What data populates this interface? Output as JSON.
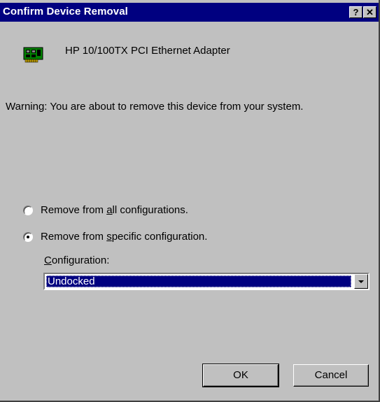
{
  "window": {
    "title": "Confirm Device Removal",
    "help_glyph": "?",
    "close_glyph": "✕"
  },
  "device": {
    "name": "HP 10/100TX PCI Ethernet Adapter",
    "icon": "network-card-icon"
  },
  "warning": "Warning: You are about to remove this device from your system.",
  "options": {
    "all": {
      "pre": "Remove from ",
      "accel": "a",
      "post": "ll configurations.",
      "checked": false
    },
    "specific": {
      "pre": "Remove from ",
      "accel": "s",
      "post": "pecific configuration.",
      "checked": true
    }
  },
  "configuration": {
    "accel": "C",
    "label_rest": "onfiguration:",
    "selected": "Undocked"
  },
  "buttons": {
    "ok": "OK",
    "cancel": "Cancel"
  },
  "colors": {
    "titlebar": "#000080",
    "face": "#c0c0c0",
    "selection": "#000080"
  }
}
